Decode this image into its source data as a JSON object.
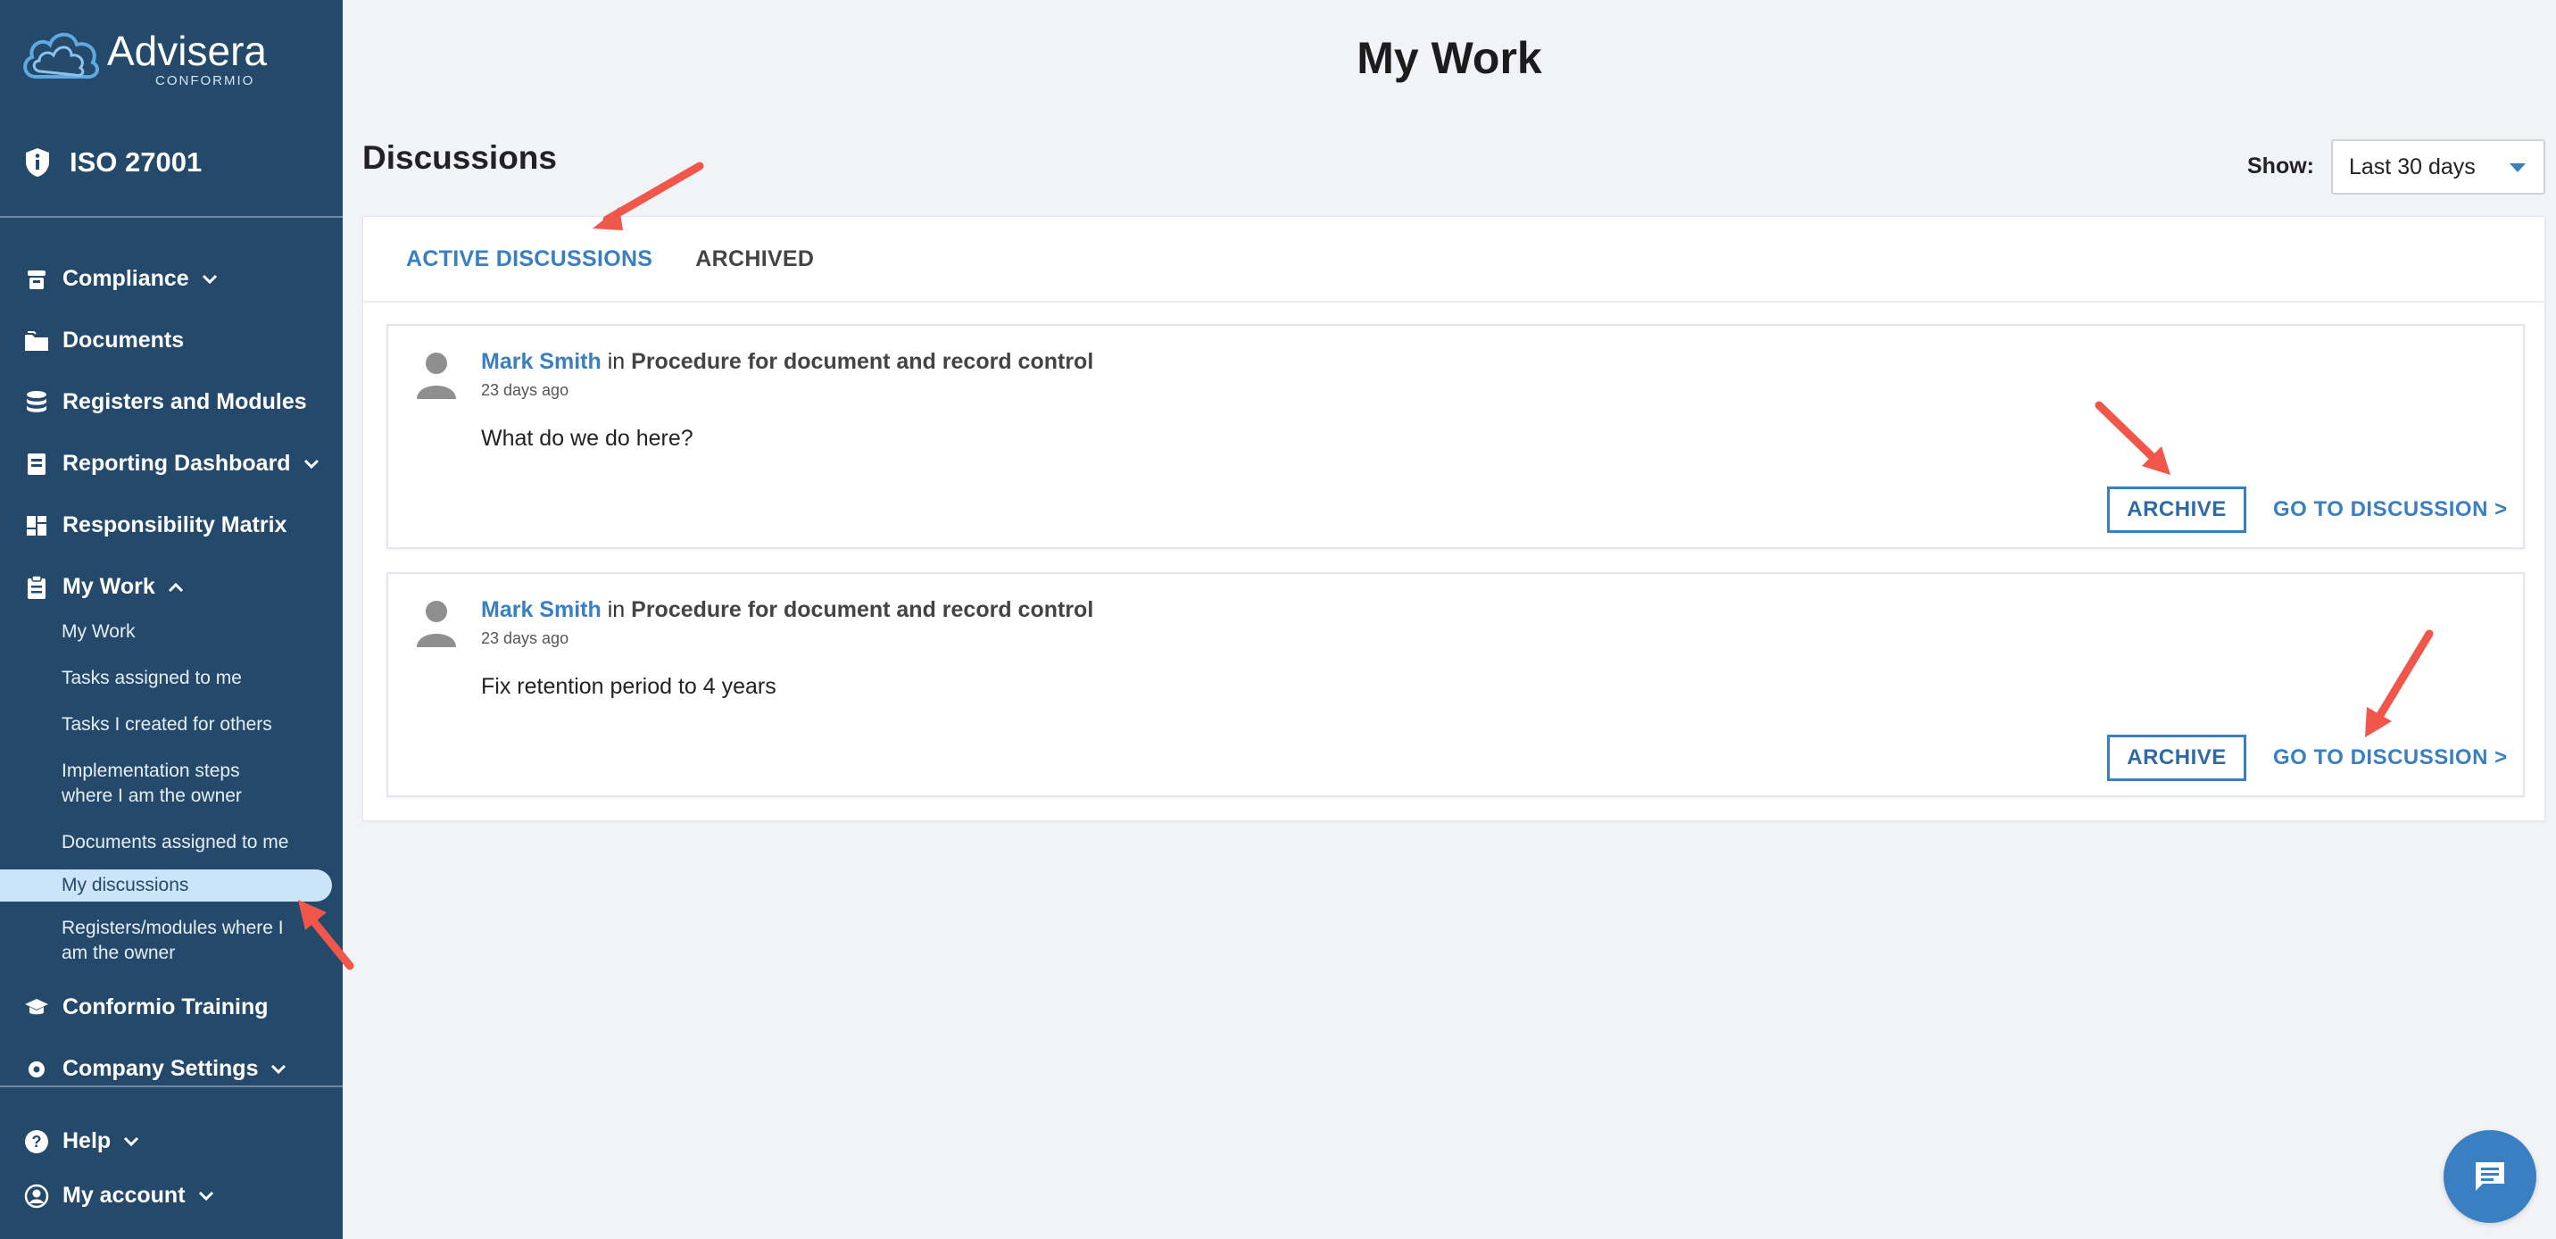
{
  "brand": {
    "name": "Advisera",
    "sub": "CONFORMIO"
  },
  "product": {
    "name": "ISO 27001"
  },
  "sidebar": {
    "items": [
      {
        "label": "Compliance",
        "icon": "box-icon",
        "chevron": "down"
      },
      {
        "label": "Documents",
        "icon": "folders-icon"
      },
      {
        "label": "Registers and Modules",
        "icon": "database-icon"
      },
      {
        "label": "Reporting Dashboard",
        "icon": "report-icon",
        "chevron": "down"
      },
      {
        "label": "Responsibility Matrix",
        "icon": "grid-icon"
      },
      {
        "label": "My Work",
        "icon": "clipboard-icon",
        "chevron": "up"
      }
    ],
    "my_work_sub": [
      "My Work",
      "Tasks assigned to me",
      "Tasks I created for others",
      "Implementation steps where I am the owner",
      "Documents assigned to me",
      "My discussions",
      "Registers/modules where I am the owner"
    ],
    "after_items": [
      {
        "label": "Conformio Training",
        "icon": "graduation-cap-icon"
      },
      {
        "label": "Company Settings",
        "icon": "gear-icon",
        "chevron": "down"
      }
    ],
    "bottom": [
      {
        "label": "Help",
        "icon": "help-icon",
        "chevron": "down"
      },
      {
        "label": "My account",
        "icon": "user-circle-icon",
        "chevron": "down"
      }
    ],
    "active_sub": "My discussions"
  },
  "page": {
    "title": "My Work",
    "section_title": "Discussions"
  },
  "filter": {
    "show_label": "Show:",
    "selected": "Last 30 days"
  },
  "tabs": [
    {
      "label": "ACTIVE DISCUSSIONS",
      "active": true
    },
    {
      "label": "ARCHIVED",
      "active": false
    }
  ],
  "discussions": [
    {
      "author": "Mark Smith",
      "in_text": "in",
      "document": "Procedure for document and record control",
      "time": "23 days ago",
      "message": "What do we do here?",
      "archive_label": "ARCHIVE",
      "go_label": "GO TO DISCUSSION >"
    },
    {
      "author": "Mark Smith",
      "in_text": "in",
      "document": "Procedure for document and record control",
      "time": "23 days ago",
      "message": "Fix retention period to 4 years",
      "archive_label": "ARCHIVE",
      "go_label": "GO TO DISCUSSION >"
    }
  ],
  "colors": {
    "sidebar_bg": "#24496b",
    "accent": "#3a7fc1",
    "annotation_arrow": "#f0574a",
    "page_bg": "#f1f3f7"
  }
}
